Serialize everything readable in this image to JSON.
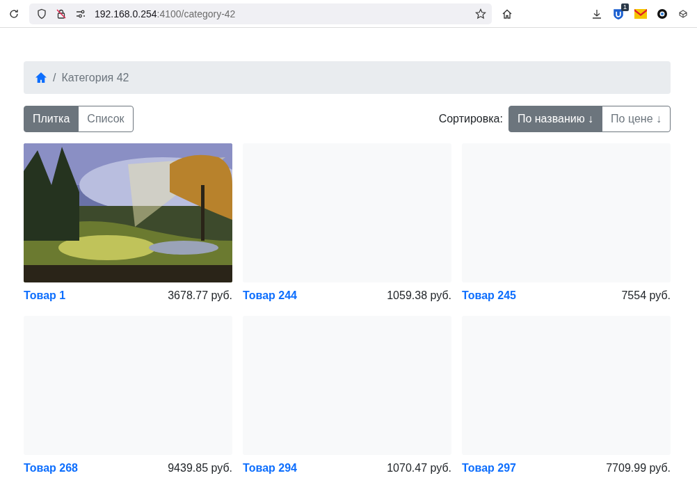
{
  "browser": {
    "url_host": "192.168.0.254",
    "url_rest": ":4100/category-42",
    "extension_badge": "1"
  },
  "breadcrumb": {
    "items": [
      {
        "separator": "/",
        "label": "Категория 42"
      }
    ]
  },
  "view_toggle": [
    {
      "label": "Плитка",
      "selected": true
    },
    {
      "label": "Список",
      "selected": false
    }
  ],
  "sort": {
    "label": "Сортировка:",
    "options": [
      {
        "label": "По названию ↓",
        "selected": true
      },
      {
        "label": "По цене ↓",
        "selected": false
      }
    ]
  },
  "products": [
    {
      "name": "Товар 1",
      "price": "3678.77 руб.",
      "kind": "picture"
    },
    {
      "name": "Товар 244",
      "price": "1059.38 руб.",
      "kind": "placeholder"
    },
    {
      "name": "Товар 245",
      "price": "7554 руб.",
      "kind": "placeholder"
    },
    {
      "name": "Товар 268",
      "price": "9439.85 руб.",
      "kind": "placeholder"
    },
    {
      "name": "Товар 294",
      "price": "1070.47 руб.",
      "kind": "placeholder"
    },
    {
      "name": "Товар 297",
      "price": "7709.99 руб.",
      "kind": "placeholder"
    }
  ]
}
